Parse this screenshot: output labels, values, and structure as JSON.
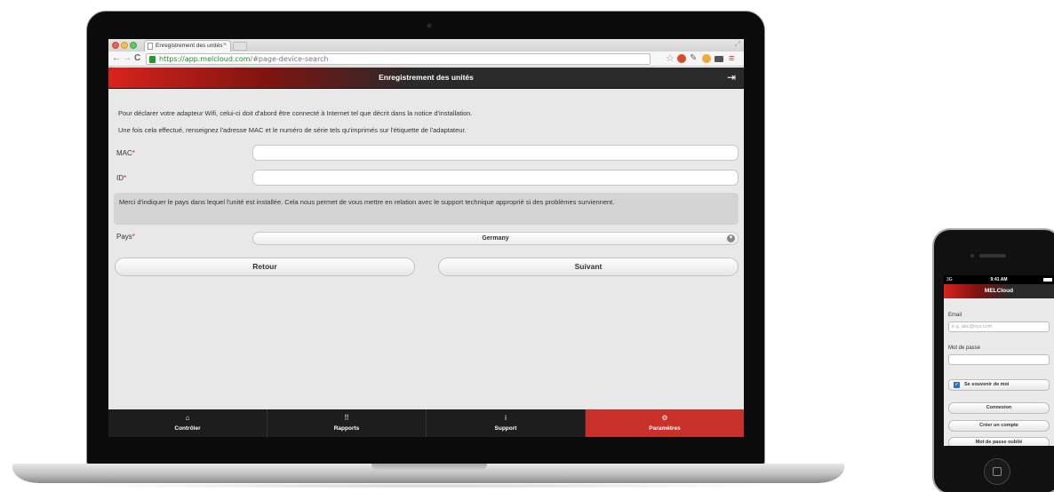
{
  "browser": {
    "tab_title": "Enregistrement des unités",
    "tab_close": "×",
    "url_scheme": "https://",
    "url_host": "app.melcloud.com",
    "url_path": "/#page-device-search"
  },
  "app": {
    "header_title": "Enregistrement des unités",
    "intro_line_1": "Pour déclarer votre adapteur Wifi, celui-ci doit d'abord être connecté à Internet tel que décrit dans la notice d'installation.",
    "intro_line_2": "Une fois cela effectué, renseignez l'adresse MAC et le numéro de série tels qu'imprimés sur l'étiquette de l'adaptateur.",
    "mac_label": "MAC",
    "id_label": "ID",
    "required_mark": "*",
    "mac_value": "",
    "id_value": "",
    "notice_text": "Merci d'indiquer le pays dans lequel l'unité est installée. Cela nous permet de vous mettre en relation avec le support technique approprié si des problèmes surviennent.",
    "country_label": "Pays",
    "country_value": "Germany",
    "back_button": "Retour",
    "next_button": "Suivant",
    "accent_color": "#d8231c"
  },
  "tabbar": {
    "items": [
      {
        "label": "Contrôler",
        "icon": "home-icon",
        "active": false
      },
      {
        "label": "Rapports",
        "icon": "grid-icon",
        "active": false
      },
      {
        "label": "Support",
        "icon": "info-icon",
        "active": false
      },
      {
        "label": "Paramètres",
        "icon": "gear-icon",
        "active": true
      }
    ],
    "active_color": "#c9302a"
  },
  "phone": {
    "status_signal": "3G",
    "status_time": "9:41 AM",
    "header_title": "MELCloud",
    "email_label": "Email",
    "email_placeholder": "e.g. abc@xyz.com",
    "password_label": "Mot de passe",
    "remember_label": "Se souvenir de moi",
    "remember_checked": true,
    "login_button": "Connexion",
    "create_button": "Créer un compte",
    "forgot_button": "Mot de passe oublié"
  }
}
